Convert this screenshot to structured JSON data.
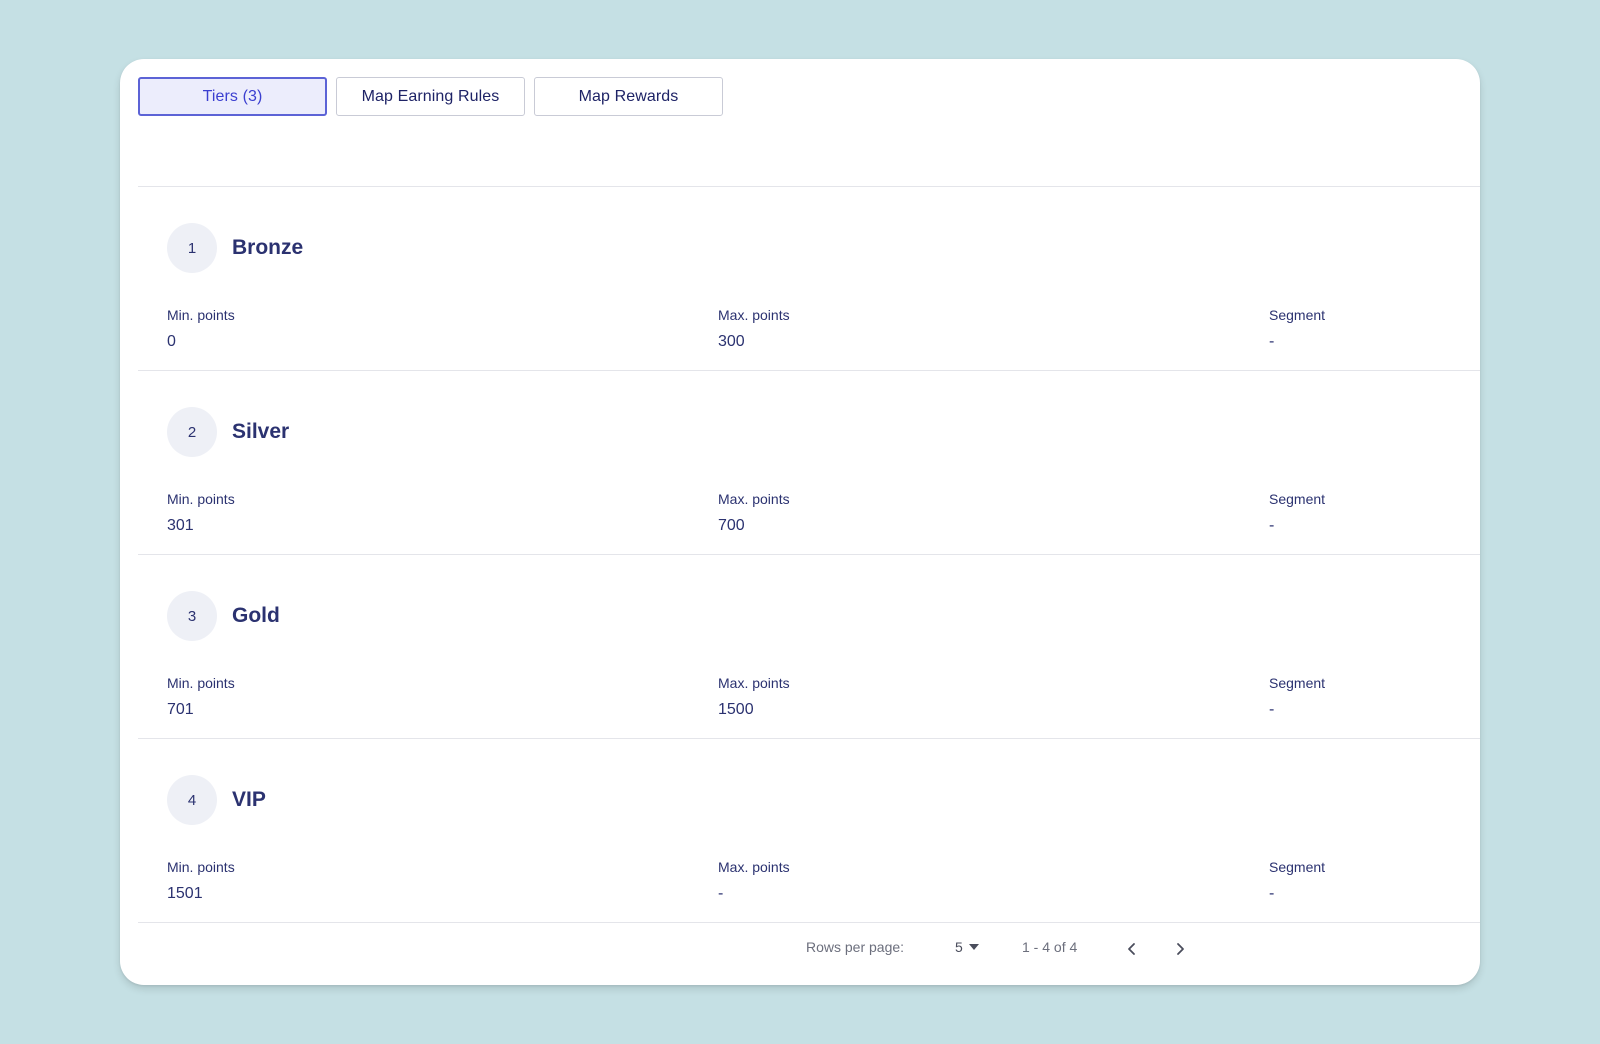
{
  "tabs": [
    {
      "label": "Tiers (3)",
      "active": true
    },
    {
      "label": "Map Earning Rules",
      "active": false
    },
    {
      "label": "Map Rewards",
      "active": false
    }
  ],
  "tiers": [
    {
      "number": "1",
      "name": "Bronze",
      "min_label": "Min. points",
      "min_value": "0",
      "max_label": "Max. points",
      "max_value": "300",
      "segment_label": "Segment",
      "segment_value": "-"
    },
    {
      "number": "2",
      "name": "Silver",
      "min_label": "Min. points",
      "min_value": "301",
      "max_label": "Max. points",
      "max_value": "700",
      "segment_label": "Segment",
      "segment_value": "-"
    },
    {
      "number": "3",
      "name": "Gold",
      "min_label": "Min. points",
      "min_value": "701",
      "max_label": "Max. points",
      "max_value": "1500",
      "segment_label": "Segment",
      "segment_value": "-"
    },
    {
      "number": "4",
      "name": "VIP",
      "min_label": "Min. points",
      "min_value": "1501",
      "max_label": "Max. points",
      "max_value": "-",
      "segment_label": "Segment",
      "segment_value": "-"
    }
  ],
  "pagination": {
    "rows_label": "Rows per page:",
    "rows_value": "5",
    "range": "1 - 4 of 4",
    "prev_icon": "chevron-left-icon",
    "next_icon": "chevron-right-icon"
  },
  "colors": {
    "background": "#c5e0e4",
    "text": "#2b3270",
    "accent": "#5c63d6",
    "active_tab_bg": "#ecedfc"
  }
}
